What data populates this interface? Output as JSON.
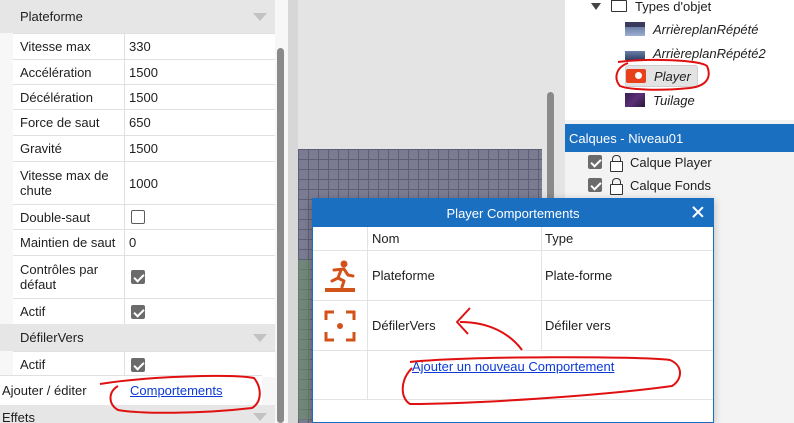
{
  "properties": {
    "section_plateforme": "Plateforme",
    "rows": [
      {
        "label": "Vitesse max",
        "value": "330"
      },
      {
        "label": "Accélération",
        "value": "1500"
      },
      {
        "label": "Décélération",
        "value": "1500"
      },
      {
        "label": "Force de saut",
        "value": "650"
      },
      {
        "label": "Gravité",
        "value": "1500"
      },
      {
        "label": "Vitesse max de chute",
        "value": "1000"
      },
      {
        "label": "Double-saut",
        "checked": false
      },
      {
        "label": "Maintien de saut",
        "value": "0"
      },
      {
        "label": "Contrôles par défaut",
        "checked": true
      },
      {
        "label": "Actif",
        "checked": true
      }
    ],
    "section_defiler": "DéfilerVers",
    "defiler_rows": [
      {
        "label": "Actif",
        "checked": true
      }
    ],
    "add_label": "Ajouter / éditer",
    "add_link": "Comportements",
    "section_effets": "Effets"
  },
  "tree": {
    "header": "Types d'objet",
    "items": [
      {
        "label": "ArrièreplanRépété",
        "icon": "background-icon"
      },
      {
        "label": "ArrièreplanRépété2",
        "icon": "background2-icon"
      },
      {
        "label": "Player",
        "icon": "player-icon"
      },
      {
        "label": "Tuilage",
        "icon": "tilemap-icon"
      }
    ]
  },
  "layers": {
    "title": "Calques - Niveau01",
    "items": [
      {
        "label": "Calque Player",
        "visible": true
      },
      {
        "label": "Calque Fonds",
        "visible": true
      }
    ]
  },
  "dialog": {
    "title": "Player Comportements",
    "col_name": "Nom",
    "col_type": "Type",
    "behaviors": [
      {
        "name": "Plateforme",
        "type": "Plate-forme",
        "icon": "platform-runner-icon"
      },
      {
        "name": "DéfilerVers",
        "type": "Défiler vers",
        "icon": "scroll-to-icon"
      }
    ],
    "add_link": "Ajouter un nouveau Comportement"
  },
  "colors": {
    "accent": "#1b6fc1",
    "behavior_icon": "#d2521a",
    "annotation": "#e01010"
  }
}
